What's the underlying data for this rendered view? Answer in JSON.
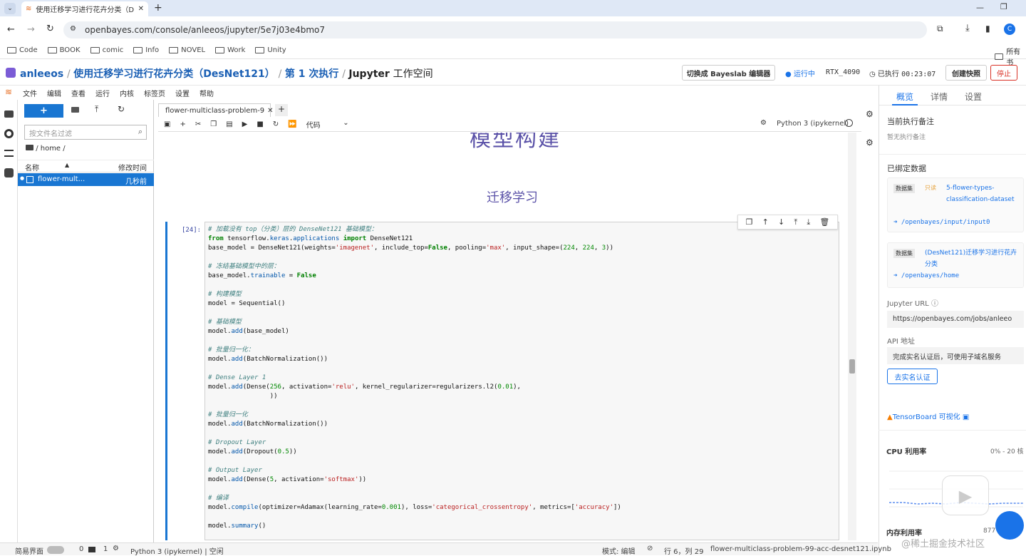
{
  "browser": {
    "tab_title": "使用迁移学习进行花卉分类（D",
    "url": "openbayes.com/console/anleeos/jupyter/5e7j03e4bmo7",
    "profile_initial": "C",
    "bookmarks": [
      "Code",
      "BOOK",
      "comic",
      "Info",
      "NOVEL",
      "Work",
      "Unity"
    ],
    "bookmarks_right": "所有书"
  },
  "header": {
    "user": "anleeos",
    "project": "使用迁移学习进行花卉分类（DesNet121）",
    "run": "第 1 次执行",
    "workspace_bold": "Jupyter",
    "workspace_rest": "工作空间",
    "switch_editor": "切换成 Bayeslab 编辑器",
    "status": "运行中",
    "gpu": "RTX_4090",
    "elapsed_label": "已执行",
    "elapsed": "00:23:07",
    "snapshot": "创建快照",
    "stop": "停止"
  },
  "menu": [
    "文件",
    "编辑",
    "查看",
    "运行",
    "内核",
    "标签页",
    "设置",
    "帮助"
  ],
  "filebrowser": {
    "new_button": "+",
    "filter_placeholder": "按文件名过滤",
    "path": "/ home /",
    "col_name": "名称",
    "col_modified": "修改时间",
    "file_name": "flower-mult...",
    "file_time": "几秒前"
  },
  "notebook": {
    "tab_name": "flower-multiclass-problem-9",
    "cell_type": "代码",
    "kernel": "Python 3 (ipykernel)",
    "heading_partial": "模型构建",
    "heading2": "迁移学习",
    "prompt": "[24]:"
  },
  "right_panel": {
    "tabs": [
      "概览",
      "详情",
      "设置"
    ],
    "note_title": "当前执行备注",
    "note_empty": "暂无执行备注",
    "data_title": "已绑定数据",
    "dataset_tag": "数据集",
    "readonly_tag": "只读",
    "dataset1_name": "5-flower-types-classification-dataset",
    "dataset1_path": "/openbayes/input/input0",
    "dataset2_name": "(DesNet121)迁移学习进行花卉分类",
    "dataset2_path": "/openbayes/home",
    "jupyter_url_label": "Jupyter URL",
    "jupyter_url": "https://openbayes.com/jobs/anleeo",
    "api_label": "API 地址",
    "api_text": "完成实名认证后，可使用子域名服务",
    "verify_button": "去实名认证",
    "tensorboard": "TensorBoard 可视化",
    "cpu_label": "CPU 利用率",
    "cpu_range": "0% - 20 核",
    "mem_label": "内存利用率",
    "mem_value": "877 MB/"
  },
  "statusbar": {
    "simple": "简易界面",
    "zero": "0",
    "one": "1",
    "kernel": "Python 3 (ipykernel) | 空闲",
    "mode": "模式: 编辑",
    "position": "行 6，列 29",
    "file": "flower-multiclass-problem-99-acc-desnet121.ipynb"
  },
  "watermark": "@稀土掘金技术社区",
  "colors": {
    "accent": "#1a73e8",
    "cell_border": "#1976d2",
    "stop": "#d93025"
  }
}
